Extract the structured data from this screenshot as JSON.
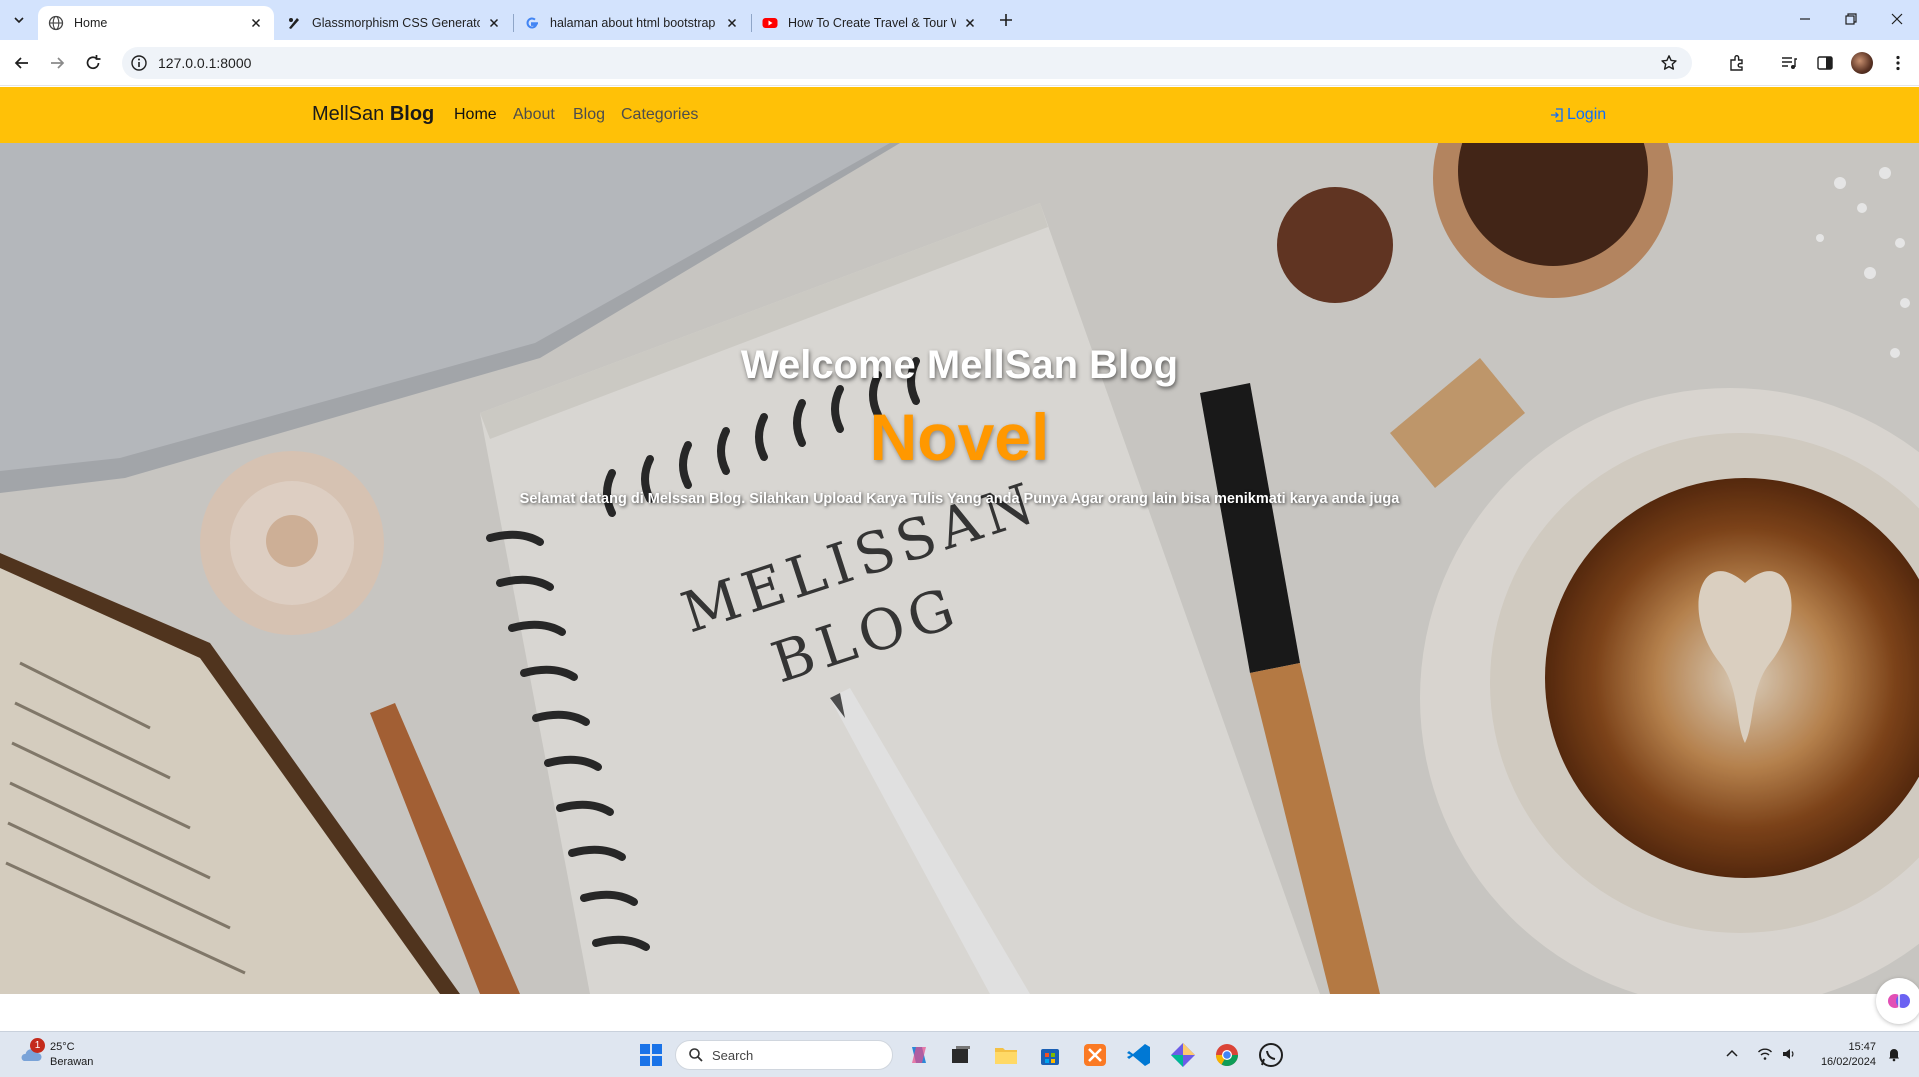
{
  "browser": {
    "tabs": [
      {
        "title": "Home",
        "favicon": "globe-icon",
        "active": true
      },
      {
        "title": "Glassmorphism CSS Generator |",
        "favicon": "glass-icon",
        "active": false
      },
      {
        "title": "halaman about html bootstrap",
        "favicon": "google-icon",
        "active": false
      },
      {
        "title": "How To Create Travel & Tour W",
        "favicon": "youtube-icon",
        "active": false
      }
    ],
    "url": "127.0.0.1:8000"
  },
  "site": {
    "brand_light": "MellSan",
    "brand_bold": "Blog",
    "nav": [
      "Home",
      "About",
      "Blog",
      "Categories"
    ],
    "login": "Login",
    "accent": "#ffc107",
    "link_color": "#0d6efd"
  },
  "hero": {
    "title": "Welcome MellSan Blog",
    "subtitle": "Novel",
    "text": "Selamat datang di Melssan Blog. Silahkan Upload Karya Tulis Yang anda Punya Agar orang lain bisa menikmati karya anda juga",
    "subtitle_color": "#ff9800",
    "image_lettering": [
      "MELISSAN",
      "BLOG"
    ]
  },
  "taskbar": {
    "weather_temp": "25°C",
    "weather_cond": "Berawan",
    "weather_badge": "1",
    "search_label": "Search",
    "time": "15:47",
    "date": "16/02/2024"
  }
}
